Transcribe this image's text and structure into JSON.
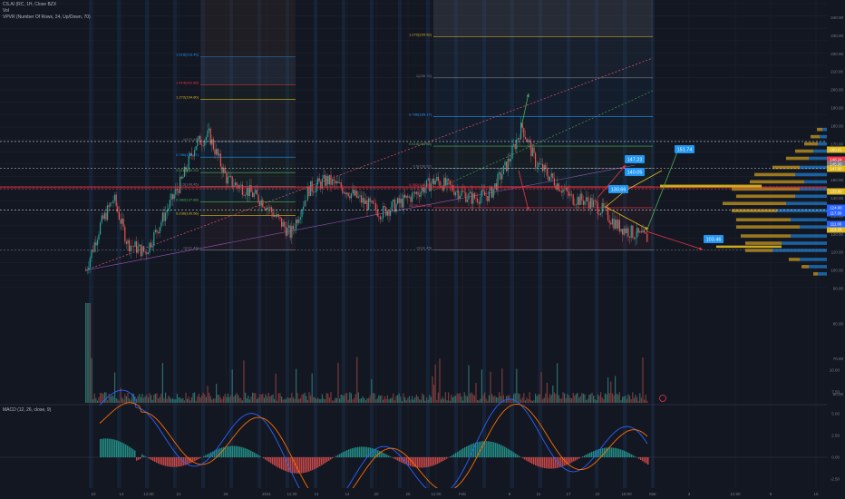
{
  "header": {
    "symbol_line": "CS.AI (RC, 1H, Close BZX",
    "vol_label": "Vol",
    "vpvr_label": "VPVR (Number Of Rows, 24, Up/Down, 70)"
  },
  "macd": {
    "label": "MACD (12, 26, close, 9)"
  },
  "price_axis": {
    "ticks": [
      "250.00",
      "240.00",
      "230.00",
      "220.00",
      "210.00",
      "200.00",
      "190.00",
      "180.00",
      "170.00",
      "160.00",
      "150.00",
      "140.00",
      "130.00",
      "120.00",
      "110.00",
      "100.00",
      "90.00",
      "80.00",
      "70.00",
      "60.00",
      "50.00",
      "40.00",
      "30.00",
      "20.00"
    ],
    "badges": [
      {
        "text": "160.01",
        "color": "#e0b91f"
      },
      {
        "text": "148.24",
        "color": "#f23645"
      },
      {
        "text": "145.00",
        "color": "#787b86"
      },
      {
        "text": "147.00",
        "color": "#e0b91f"
      },
      {
        "text": "133.00",
        "color": "#e0b91f"
      },
      {
        "text": "124.00",
        "color": "#2962ff"
      },
      {
        "text": "117.00",
        "color": "#2962ff"
      },
      {
        "text": "113.28",
        "color": "#e0b91f"
      },
      {
        "text": "111.00",
        "color": "#2962ff"
      }
    ]
  },
  "macd_axis": {
    "ticks": [
      "10.00",
      "7.50",
      "5.00",
      "2.50",
      "0.00",
      "-2.50"
    ]
  },
  "time_axis": {
    "ticks": [
      "10",
      "14",
      "12:00",
      "21",
      "28",
      "2021",
      "11:30",
      "11",
      "14",
      "20",
      "25",
      "11:00",
      "Feb",
      "8",
      "11",
      "17",
      "22",
      "15:00",
      "Mar",
      "3",
      "12:00",
      "8",
      "15"
    ]
  },
  "fib_left": {
    "levels": [
      {
        "label": "1.618(218.45)",
        "color": "#2196f3"
      },
      {
        "label": "1.414(202.88)",
        "color": "#f23645"
      },
      {
        "label": "1.272(194.80)",
        "color": "#e0b91f"
      },
      {
        "label": "1(171.45)",
        "color": "#787b86"
      },
      {
        "label": "0.786(162.77)",
        "color": "#2196f3"
      },
      {
        "label": "0.618(154.22)",
        "color": "#4caf50"
      },
      {
        "label": "0.5(146.45)",
        "color": "#787b86"
      },
      {
        "label": "0.382(137.88)",
        "color": "#4caf50"
      },
      {
        "label": "0.236(130.56)",
        "color": "#e0b91f"
      },
      {
        "label": "0(111.45)",
        "color": "#787b86"
      }
    ]
  },
  "fib_right": {
    "levels": [
      {
        "label": "1.272(229.52)",
        "color": "#e0b91f"
      },
      {
        "label": "1(206.70)",
        "color": "#787b86"
      },
      {
        "label": "0.786(185.17)",
        "color": "#2196f3"
      },
      {
        "label": "0.618(168.88)",
        "color": "#4caf50"
      },
      {
        "label": "0.5(156.52)",
        "color": "#787b86"
      },
      {
        "label": "0.382(146.35)",
        "color": "#f23645"
      },
      {
        "label": "0.236(134.78)",
        "color": "#f23645"
      },
      {
        "label": "0(111.45)",
        "color": "#787b86"
      }
    ]
  },
  "callouts": [
    {
      "text": "151.74"
    },
    {
      "text": "147.23"
    },
    {
      "text": "140.05"
    },
    {
      "text": "130.66"
    },
    {
      "text": "103.46"
    }
  ],
  "colors": {
    "background": "#131722",
    "up": "#26a69a",
    "down": "#ef5350",
    "callout": "#2196f3",
    "accent_red": "#f23645",
    "accent_yellow": "#e0b91f",
    "accent_blue": "#2962ff"
  },
  "icons": {
    "alert": "circle-icon"
  }
}
